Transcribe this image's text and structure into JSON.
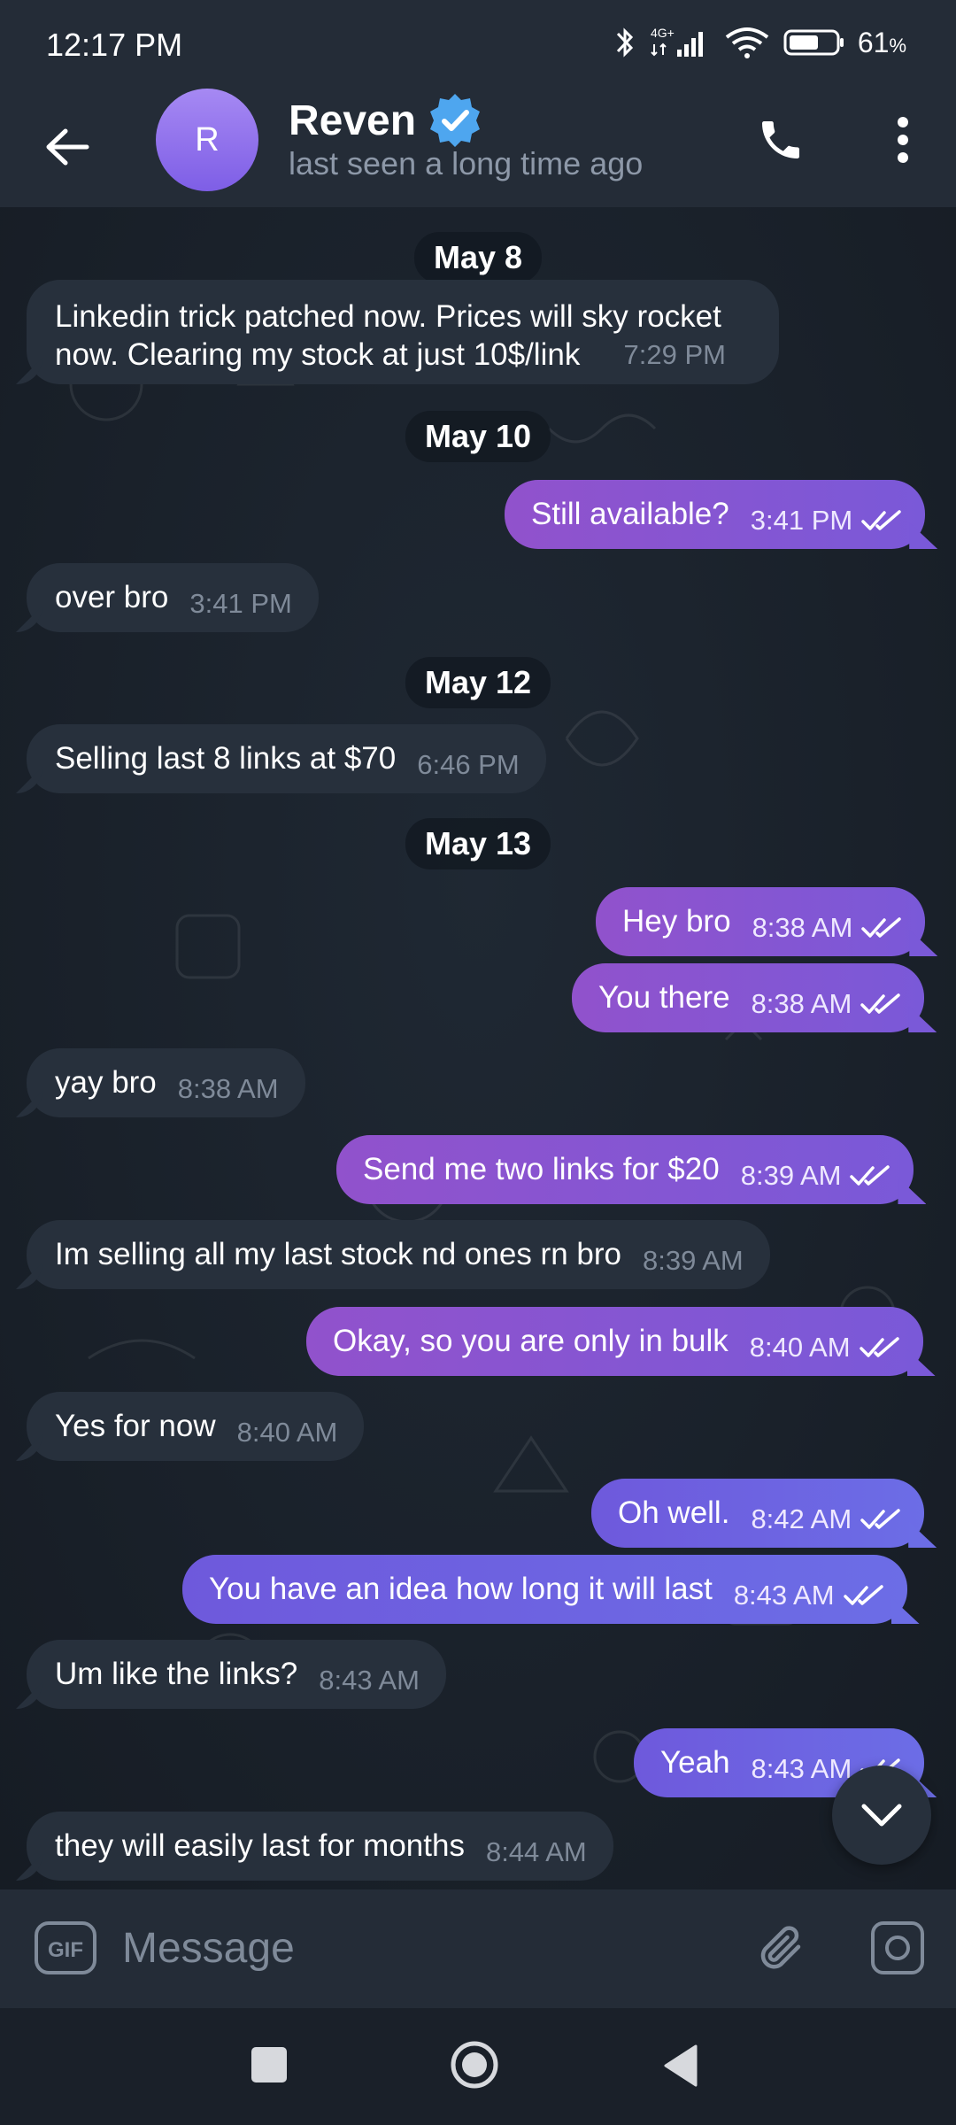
{
  "status_bar": {
    "time": "12:17 PM",
    "network": "4G+",
    "battery_pct": "61",
    "battery_unit": "%"
  },
  "header": {
    "contact_name": "Reven",
    "avatar_initial": "R",
    "last_seen": "last seen a long time ago",
    "verified": true
  },
  "chat": {
    "dates": [
      "May 8",
      "May 10",
      "May 12",
      "May 13"
    ],
    "messages": [
      {
        "dir": "in",
        "text": "Linkedin trick patched now. Prices will sky rocket now. Clearing my stock at just 10$/link",
        "time": "7:29 PM"
      },
      {
        "dir": "out",
        "text": "Still available?",
        "time": "3:41 PM",
        "read": true
      },
      {
        "dir": "in",
        "text": "over bro",
        "time": "3:41 PM"
      },
      {
        "dir": "in",
        "text": "Selling last 8 links at $70",
        "time": "6:46 PM"
      },
      {
        "dir": "out",
        "text": "Hey bro",
        "time": "8:38 AM",
        "read": true
      },
      {
        "dir": "out",
        "text": "You there",
        "time": "8:38 AM",
        "read": true
      },
      {
        "dir": "in",
        "text": "yay bro",
        "time": "8:38 AM"
      },
      {
        "dir": "out",
        "text": "Send me two links for $20",
        "time": "8:39 AM",
        "read": true
      },
      {
        "dir": "in",
        "text": "Im selling all my last stock nd ones rn bro",
        "time": "8:39 AM"
      },
      {
        "dir": "out",
        "text": "Okay, so you are only in bulk",
        "time": "8:40 AM",
        "read": true
      },
      {
        "dir": "in",
        "text": "Yes for now",
        "time": "8:40 AM"
      },
      {
        "dir": "out",
        "text": "Oh well.",
        "time": "8:42 AM",
        "read": true
      },
      {
        "dir": "out",
        "text": "You have an idea how long it will last",
        "time": "8:43 AM",
        "read": true
      },
      {
        "dir": "in",
        "text": "Um like the links?",
        "time": "8:43 AM"
      },
      {
        "dir": "out",
        "text": "Yeah",
        "time": "8:43 AM",
        "read": true
      },
      {
        "dir": "in",
        "text": "they will easily last for months",
        "time": "8:44 AM"
      }
    ]
  },
  "composer": {
    "placeholder": "Message",
    "gif_label": "GIF"
  },
  "colors": {
    "outgoing_bubble": "#8a55d0",
    "incoming_bubble": "#27303c",
    "header_bg": "#242c37",
    "verified_badge": "#4ea6ef"
  },
  "icons": [
    "back-arrow-icon",
    "verified-icon",
    "phone-icon",
    "more-vert-icon",
    "double-check-icon",
    "chevron-down-icon",
    "gif-icon",
    "paperclip-icon",
    "camera-icon",
    "nav-recent-icon",
    "nav-home-icon",
    "nav-back-icon"
  ]
}
